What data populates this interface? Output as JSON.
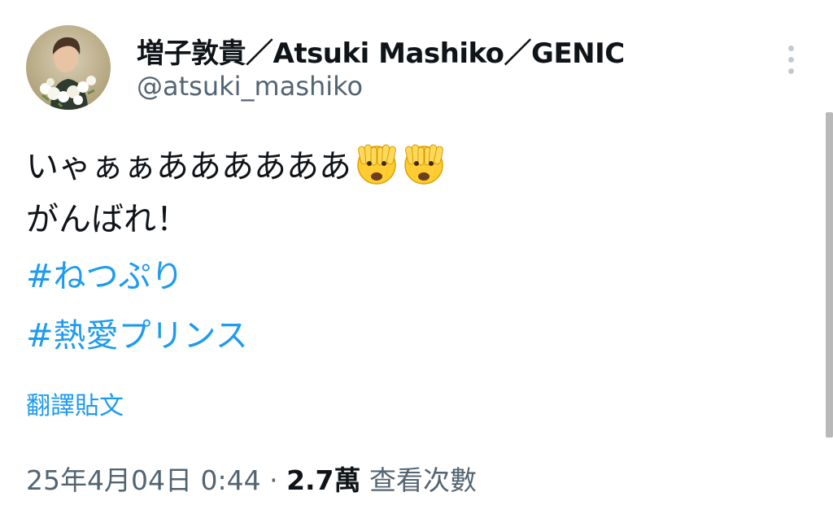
{
  "author": {
    "display_name": "増子敦貴／Atsuki Mashiko／GENIC",
    "handle": "@atsuki_mashiko",
    "avatar_icon": "profile-photo"
  },
  "more_icon": "more-vertical-icon",
  "tweet": {
    "line1_text": "いゃぁぁああああああ",
    "line1_emoji": [
      "face-with-peeking-eye",
      "face-with-peeking-eye"
    ],
    "line2_text": "がんばれ！",
    "hashtags": [
      "#ねつぷり",
      "#熱愛プリンス"
    ]
  },
  "translate_label": "翻譯貼文",
  "meta": {
    "timestamp": "25年4月04日 0:44",
    "separator": " · ",
    "views_count": "2.7萬",
    "views_label": " 查看次數"
  },
  "colors": {
    "text": "#0f1419",
    "secondary": "#536471",
    "link": "#1d9bf0",
    "emoji": "#ffcc33"
  }
}
